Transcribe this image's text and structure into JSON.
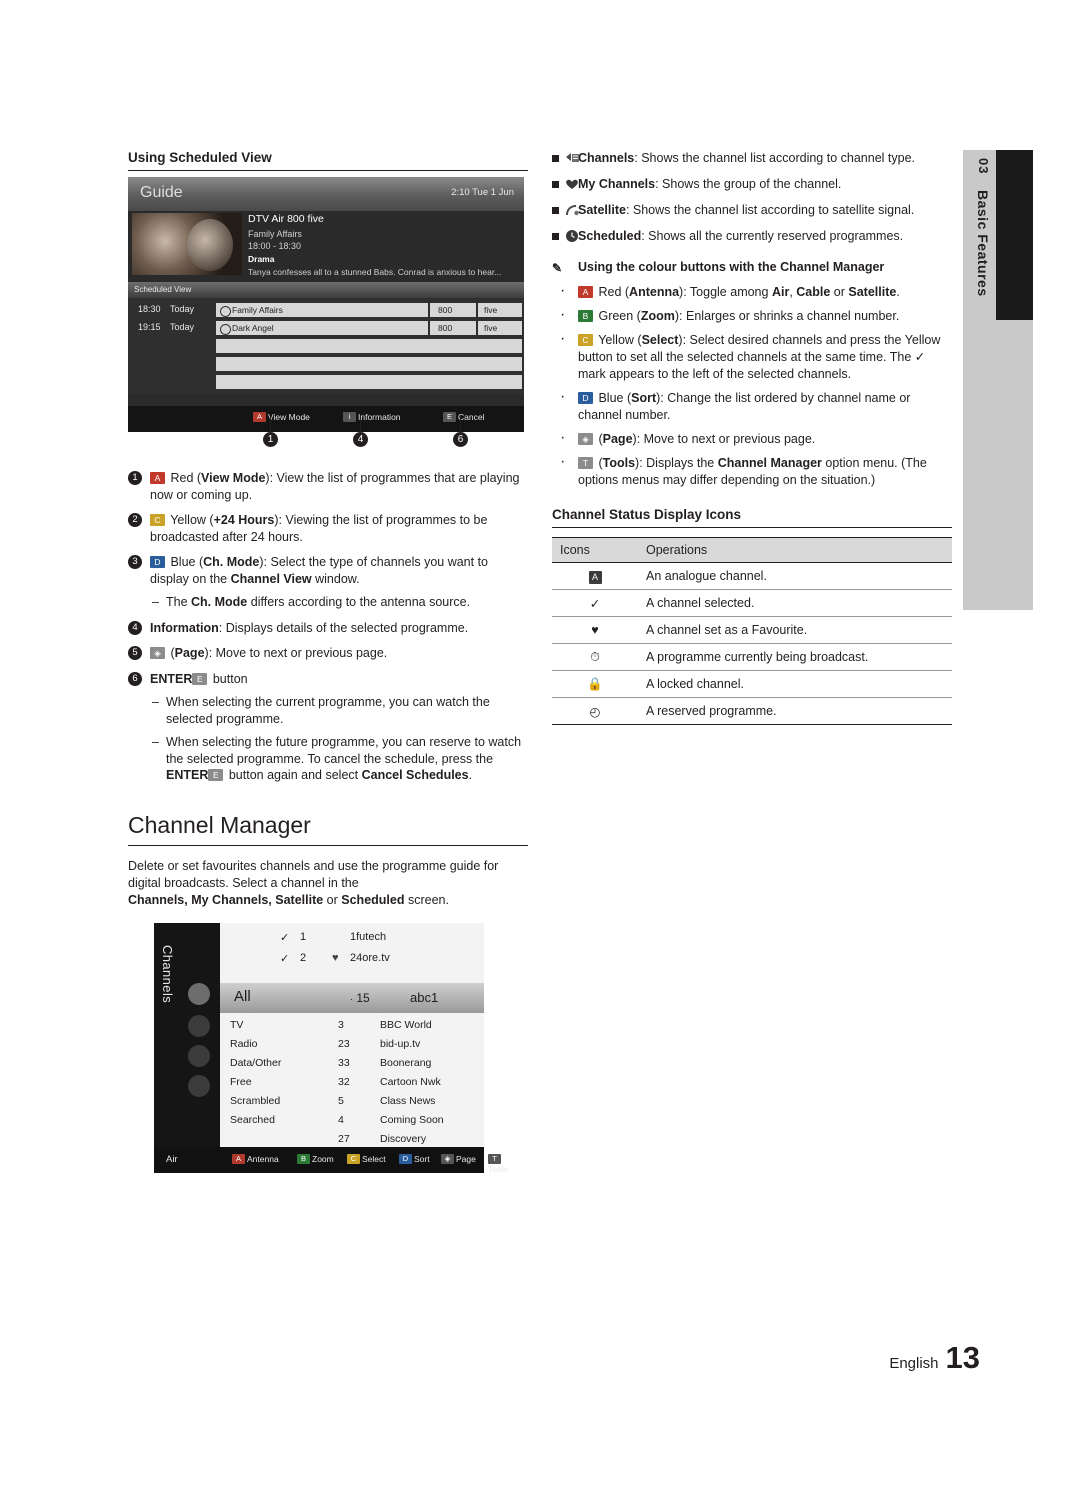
{
  "side_tab": {
    "number": "03",
    "label": "Basic Features"
  },
  "left": {
    "section_title": "Using Scheduled View",
    "guide": {
      "title": "Guide",
      "time": "2:10 Tue 1 Jun",
      "prog_channel": "DTV Air 800 five",
      "prog_name": "Family Affairs",
      "prog_time": "18:00 - 18:30",
      "prog_genre": "Drama",
      "prog_desc": "Tanya confesses all to a stunned Babs. Conrad is anxious to hear...",
      "band_label": "Scheduled View",
      "rows": [
        {
          "time": "18:30",
          "day": "Today",
          "name": "Family Affairs",
          "num": "800",
          "ch": "five"
        },
        {
          "time": "19:15",
          "day": "Today",
          "name": "Dark Angel",
          "num": "800",
          "ch": "five"
        }
      ],
      "footer": [
        {
          "key": "A",
          "label": "View Mode",
          "color": "red"
        },
        {
          "key": "i",
          "label": "Information",
          "color": "gry"
        },
        {
          "key": "E",
          "label": "Cancel",
          "color": "gry"
        }
      ],
      "callouts": [
        "1",
        "4",
        "6"
      ]
    },
    "items": [
      {
        "n": "1",
        "html": "<span class=\"ckey red\">A</span> Red (<b>View Mode</b>): View the list of programmes that are playing now or coming up."
      },
      {
        "n": "2",
        "html": "<span class=\"ckey yel\">C</span> Yellow (<b>+24 Hours</b>): Viewing the list of programmes to be broadcasted after 24 hours."
      },
      {
        "n": "3",
        "html": "<span class=\"ckey blu\">D</span> Blue (<b>Ch. Mode</b>): Select the type of channels you want to display on the <b>Channel View</b> window."
      },
      {
        "n": "4",
        "html": "<b>Information</b>: Displays details of the selected programme."
      },
      {
        "n": "5",
        "html": "<span class=\"ckey gry\">&#9672;</span> (<b>Page</b>): Move to next or previous page."
      },
      {
        "n": "6",
        "html": "<b>ENTER</b><span class=\"ckey gry\">E</span> button"
      }
    ],
    "sub_item_3": "The <b>Ch. Mode</b> differs according to the antenna source.",
    "sub_items_6": [
      "When selecting the current programme, you can watch the selected programme.",
      "When selecting the future programme, you can reserve to watch the selected programme. To cancel the schedule, press the <b>ENTER</b><span class=\"ckey gry\">E</span> button again and select <b>Cancel Schedules</b>."
    ],
    "heading": "Channel Manager",
    "body_1": "Delete or set favourites channels and use the programme guide for digital broadcasts. Select a channel in the",
    "body_2": "<b>Channels, My Channels, Satellite</b> or <b>Scheduled</b> screen.",
    "cmgr": {
      "vertical_label": "Channels",
      "top_rows": [
        {
          "mark": "✓",
          "num": "1",
          "name": "1futech",
          "fav": ""
        },
        {
          "mark": "✓",
          "num": "2",
          "name": "24ore.tv",
          "fav": "♥"
        }
      ],
      "selected_row": {
        "label": "All",
        "num": "15",
        "name": "abc1"
      },
      "categories": [
        "TV",
        "Radio",
        "Data/Other",
        "Free",
        "Scrambled",
        "Searched"
      ],
      "channel_numbers": [
        "3",
        "23",
        "33",
        "32",
        "5",
        "4",
        "27"
      ],
      "channel_names": [
        "BBC World",
        "bid-up.tv",
        "Boonerang",
        "Cartoon Nwk",
        "Class News",
        "Coming Soon",
        "Discovery"
      ],
      "footer_left": "Air",
      "footer_items": [
        {
          "key": "A",
          "label": "Antenna",
          "color": "red"
        },
        {
          "key": "B",
          "label": "Zoom",
          "color": "grn"
        },
        {
          "key": "C",
          "label": "Select",
          "color": "yel"
        },
        {
          "key": "D",
          "label": "Sort",
          "color": "blu"
        },
        {
          "key": "◇",
          "label": "Page",
          "color": "gry"
        },
        {
          "key": "T",
          "label": "Tools",
          "color": "gry"
        }
      ]
    }
  },
  "right": {
    "squares": [
      {
        "icon": "channels-icon",
        "html": "<b>Channels</b>: Shows the channel list according to channel type."
      },
      {
        "icon": "heart-icon",
        "html": "<b>My Channels</b>: Shows the group of the channel."
      },
      {
        "icon": "satellite-icon",
        "html": "<b>Satellite</b>: Shows the channel list according to satellite signal."
      },
      {
        "icon": "clock-icon",
        "html": "<b>Scheduled</b>: Shows all the currently reserved programmes."
      }
    ],
    "note": "Using the colour buttons with the <b>Channel Manager</b>",
    "dots": [
      "<span class=\"ckey red\">A</span> Red (<b>Antenna</b>): Toggle among <b>Air</b>, <b>Cable</b> or <b>Satellite</b>.",
      "<span class=\"ckey grn\">B</span> Green (<b>Zoom</b>): Enlarges or shrinks a channel number.",
      "<span class=\"ckey yel\">C</span> Yellow (<b>Select</b>): Select desired channels and press the Yellow button to set all the selected channels at the same time. The &#10003; mark appears to the left of the selected channels.",
      "<span class=\"ckey blu\">D</span> Blue (<b>Sort</b>): Change the list ordered by channel name or channel number.",
      "<span class=\"ckey gry\">&#9672;</span> (<b>Page</b>): Move to next or previous page.",
      "<span class=\"ckey gry\">T</span> (<b>Tools</b>): Displays the <b>Channel Manager</b> option menu. (The options menus may differ depending on the situation.)"
    ],
    "table_title": "Channel Status Display Icons",
    "table": {
      "headers": [
        "Icons",
        "Operations"
      ],
      "rows": [
        {
          "icon": "A",
          "icon_type": "key",
          "op": "An analogue channel."
        },
        {
          "icon": "✓",
          "icon_type": "glyph",
          "op": "A channel selected."
        },
        {
          "icon": "♥",
          "icon_type": "glyph",
          "op": "A channel set as a Favourite."
        },
        {
          "icon": "⏱",
          "icon_type": "glyph",
          "op": "A programme currently being broadcast."
        },
        {
          "icon": "🔒",
          "icon_type": "glyph",
          "op": "A locked channel."
        },
        {
          "icon": "◴",
          "icon_type": "glyph",
          "op": "A reserved programme."
        }
      ]
    }
  },
  "footer": {
    "language": "English",
    "page": "13"
  }
}
